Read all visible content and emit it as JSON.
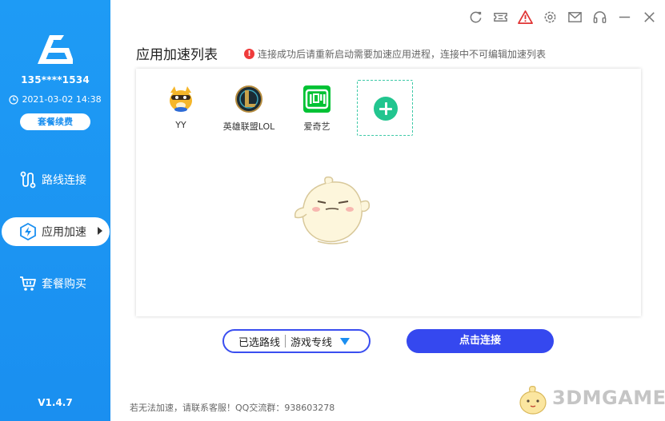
{
  "sidebar": {
    "account": "135****1534",
    "expire_date": "2021-03-02 14:38",
    "renew_label": "套餐续费",
    "nav": {
      "route_label": "路线连接",
      "accel_label": "应用加速",
      "buy_label": "套餐购买"
    },
    "version": "V1.4.7"
  },
  "titlebar": {
    "icons": [
      "refresh-icon",
      "ticket-icon",
      "warning-icon",
      "settings-icon",
      "mail-icon",
      "headset-icon",
      "minimize-icon",
      "close-icon"
    ]
  },
  "main": {
    "title": "应用加速列表",
    "notice": "连接成功后请重新启动需要加速应用进程，连接中不可编辑加速列表",
    "apps": [
      {
        "name": "YY",
        "icon": "yy-icon"
      },
      {
        "name": "英雄联盟LOL",
        "icon": "lol-icon"
      },
      {
        "name": "爱奇艺",
        "icon": "iqiyi-icon"
      }
    ],
    "route_select": {
      "label": "已选路线",
      "value": "游戏专线"
    },
    "connect_label": "点击连接",
    "footer": "若无法加速，请联系客服！QQ交流群：938603278"
  },
  "watermark": {
    "text": "3DMGAME"
  },
  "colors": {
    "sidebar_bg": "#1a8ff0",
    "accent_blue": "#3548ef",
    "add_green": "#22c58f",
    "warning_red": "#ef3b3b"
  }
}
